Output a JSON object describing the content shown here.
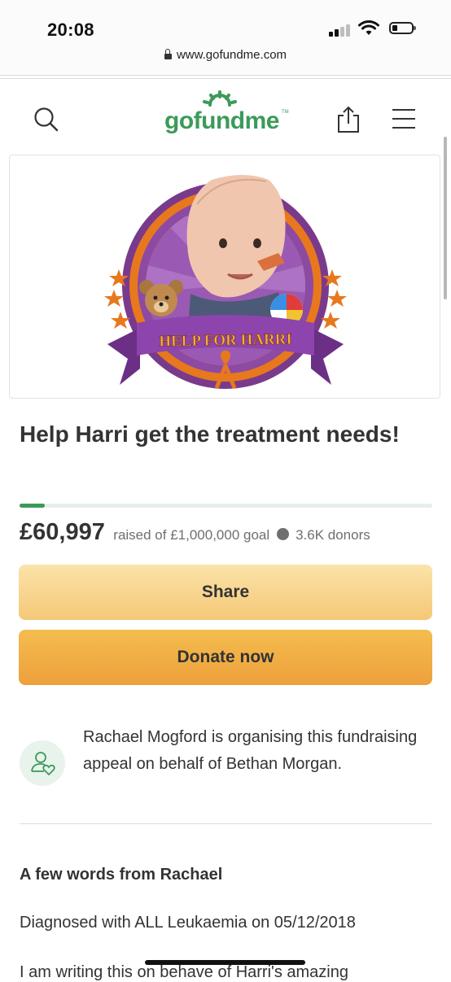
{
  "status_bar": {
    "time": "20:08"
  },
  "browser": {
    "url": "www.gofundme.com"
  },
  "header": {
    "logo": "gofundme",
    "logo_tm": "TM"
  },
  "hero": {
    "banner_text": "HELP FOR HARRI"
  },
  "campaign": {
    "title": "Help Harri get the treatment needs!",
    "progress_fraction": 0.061,
    "amount_raised": "£60,997",
    "goal_text": "raised of £1,000,000 goal",
    "donors": "3.6K donors"
  },
  "actions": {
    "share_label": "Share",
    "donate_label": "Donate now"
  },
  "organiser": {
    "text": "Rachael Mogford is organising this fundraising appeal on behalf of Bethan Morgan."
  },
  "story": {
    "heading": "A few words from Rachael",
    "line1": "Diagnosed with ALL Leukaemia on 05/12/2018",
    "line2": "I am writing this on behave of Harri's amazing"
  },
  "colors": {
    "brand_green": "#3d9a5a",
    "share_button": "#f8d690",
    "donate_button": "#f1ad45",
    "banner_purple": "#8e44ad",
    "ring_orange": "#e87722"
  }
}
